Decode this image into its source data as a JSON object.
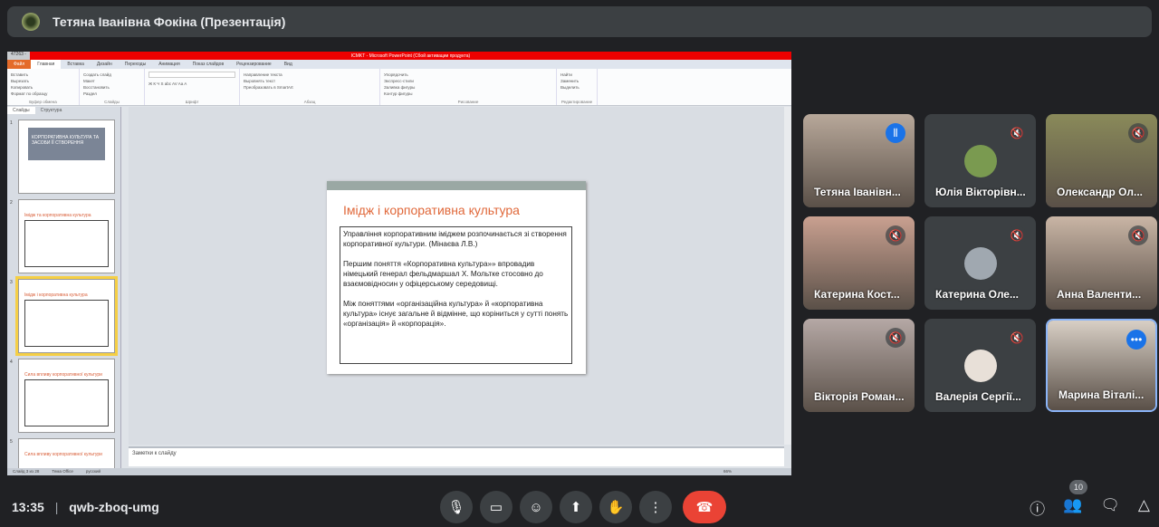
{
  "header": {
    "presenter_title": "Тетяна Іванівна Фокіна (Презентація)"
  },
  "powerpoint": {
    "window_left": "47263 -",
    "window_title": "ICMKT - Microsoft PowerPoint (Сбой активации продукта)",
    "tabs": [
      "Файл",
      "Главная",
      "Вставка",
      "Дизайн",
      "Переходы",
      "Анимация",
      "Показ слайдов",
      "Рецензирование",
      "Вид"
    ],
    "groups": [
      {
        "name": "Буфер обмена",
        "items": [
          "Вставить",
          "Вырезать",
          "Копировать",
          "Формат по образцу"
        ]
      },
      {
        "name": "Слайды",
        "items": [
          "Создать слайд",
          "Макет",
          "Восстановить",
          "Раздел"
        ]
      },
      {
        "name": "Шрифт",
        "items": [
          "Ж К Ч S abc AV Aa A"
        ]
      },
      {
        "name": "Абзац",
        "items": [
          "Направление текста",
          "Выровнять текст",
          "Преобразовать в SmartArt"
        ]
      },
      {
        "name": "Рисование",
        "items": [
          "Упорядочить",
          "Экспресс-стили",
          "Заливка фигуры",
          "Контур фигуры",
          "Эффекты фигуры"
        ]
      },
      {
        "name": "Редактирование",
        "items": [
          "Найти",
          "Заменить",
          "Выделить"
        ]
      }
    ],
    "panel_tabs": [
      "Слайды",
      "Структура"
    ],
    "thumbnails": [
      {
        "num": "1",
        "title": "КОРПОРАТИВНА КУЛЬТУРА ТА ЗАСОБИ ЇЇ СТВОРЕННЯ"
      },
      {
        "num": "2",
        "title": "Імідж та корпоративна культура"
      },
      {
        "num": "3",
        "title": "Імідж і корпоративна культура"
      },
      {
        "num": "4",
        "title": "Сила впливу корпоративної культури"
      },
      {
        "num": "5",
        "title": "Сила впливу корпоративної культури"
      }
    ],
    "slide": {
      "title": "Імідж і корпоративна культура",
      "paragraphs": [
        "Управління корпоративним іміджем розпочинається зі створення корпоративної культури. (Мінаєва Л.В.)",
        "Першим поняття «Корпоративна культура»» впровадив німецький генерал фельдмаршал Х. Мольтке стосовно до взаємовідносин у офіцерському середовищі.",
        "Між поняттями «організаційна культура» й «корпоративна культура» існує загальне й відмінне, що коріниться у сутті понять «організація» й «корпорація»."
      ]
    },
    "notes_placeholder": "Заметки к слайду",
    "status": {
      "slide": "Слайд 3 из 28",
      "theme": "Тема Office",
      "lang": "русский",
      "zoom": "66%"
    }
  },
  "participants": [
    {
      "name": "Тетяна Іванівн...",
      "state": "speaking",
      "color": "#b8a89a"
    },
    {
      "name": "Юлія Вікторівн...",
      "state": "muted",
      "avatar": "#7a9a50"
    },
    {
      "name": "Олександр Ол...",
      "state": "muted",
      "color": "#8a8a5a"
    },
    {
      "name": "Катерина Кост...",
      "state": "muted",
      "color": "#c9a090"
    },
    {
      "name": "Катерина Оле...",
      "state": "muted",
      "avatar": "#a0a8b0"
    },
    {
      "name": "Анна Валенти...",
      "state": "muted",
      "color": "#c9b5a5"
    },
    {
      "name": "Вікторія Роман...",
      "state": "muted",
      "color": "#b5a8a5"
    },
    {
      "name": "Валерія Сергії...",
      "state": "muted",
      "avatar": "#e8e0d8"
    },
    {
      "name": "Марина Віталі...",
      "state": "self",
      "color": "#d8cfc5"
    }
  ],
  "bottom": {
    "time": "13:35",
    "meeting_code": "qwb-zboq-umg",
    "participant_count": "10"
  }
}
